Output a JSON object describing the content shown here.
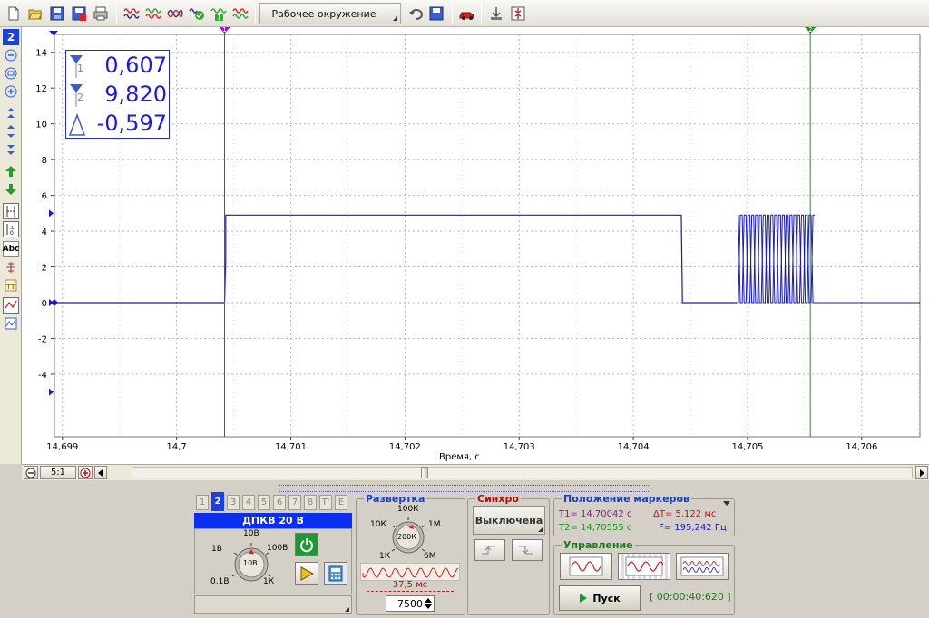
{
  "toolbar": {
    "workspace_label": "Рабочее окружение",
    "icons": [
      "new-file-icon",
      "open-folder-icon",
      "save-icon",
      "save-red-icon",
      "print-icon",
      "wave-icon-1",
      "wave-icon-2",
      "wave-icon-3",
      "wave-check-icon",
      "wave-1-icon",
      "wave-ok-icon",
      "undo-icon",
      "save-workspace-icon",
      "car-icon",
      "connect-icon",
      "split-icon"
    ]
  },
  "left_tools": {
    "channel_number": "2",
    "text_tool": "Abc"
  },
  "plot": {
    "y_ticks": [
      "14",
      "12",
      "10",
      "8",
      "6",
      "4",
      "2",
      "0",
      "-2",
      "-4"
    ],
    "x_ticks": [
      "14,699",
      "14,7",
      "14,701",
      "14,702",
      "14,703",
      "14,704",
      "14,705",
      "14,706"
    ],
    "x_label": "Время, с",
    "marker1_label": "1",
    "marker2_label": "2",
    "colors": {
      "trace": "#1a1ab8",
      "marker1": "#9a1ab8",
      "marker2": "#159a15",
      "grid": "#b8b8b8"
    }
  },
  "chart_data": {
    "type": "line",
    "xlabel": "Время, с",
    "ylabel": "",
    "xlim": [
      14.69893,
      14.70651
    ],
    "ylim": [
      -7.5,
      15
    ],
    "grid": true,
    "series": [
      {
        "x": [
          14.69893,
          14.70042,
          14.70043,
          14.70442,
          14.70443,
          14.70491,
          14.70492,
          14.70559,
          14.7056,
          14.70651
        ],
        "values": [
          0,
          0,
          4.9,
          4.9,
          0,
          0,
          2.5,
          2.5,
          0,
          0
        ]
      }
    ],
    "markers": {
      "T1": 14.70042,
      "T2": 14.70555
    }
  },
  "readout": {
    "v1": "0,607",
    "v2": "9,820",
    "delta": "-0,597",
    "sub1": "1",
    "sub2": "2"
  },
  "scroll": {
    "zoom_label": "5:1"
  },
  "channel_panel": {
    "tabs": [
      "1",
      "2",
      "3",
      "4",
      "5",
      "6",
      "7",
      "8",
      "T'",
      "E"
    ],
    "active_tab": "2",
    "header": "ДПКВ 20 В",
    "knob_labels": {
      "top": "10В",
      "left": "1В",
      "right": "100В",
      "center": "10В",
      "bl": "0,1В",
      "br": "1К"
    }
  },
  "sweep_panel": {
    "title": "Развертка",
    "knob_labels": {
      "top": "100К",
      "tl": "10К",
      "tr": "1М",
      "center": "200К",
      "bl": "1К",
      "br": "6М"
    },
    "duration": "37,5 мс",
    "points": "7500"
  },
  "sync_panel": {
    "title": "Синхро",
    "mode": "Выключена"
  },
  "markers_panel": {
    "title": "Положение маркеров",
    "t1": "T1= 14,70042 с",
    "t2": "T2= 14,70555 с",
    "dt": "ΔT= 5,122 мс",
    "freq": "F= 195,242 Гц"
  },
  "control_panel": {
    "title": "Управление",
    "start_label": "Пуск",
    "timer": "[ 00:00:40:620 ]"
  }
}
